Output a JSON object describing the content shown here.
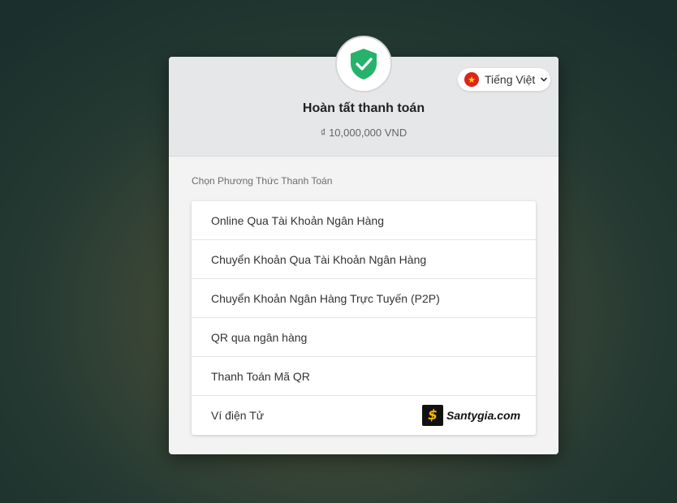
{
  "header": {
    "title": "Hoàn tất thanh toán",
    "amount": "₫ 10,000,000 VND",
    "status_icon": "shield-check-icon"
  },
  "language": {
    "label": "Tiếng Việt",
    "flag_icon": "vietnam-flag-icon",
    "flag_star": "★"
  },
  "payment": {
    "section_label": "Chọn Phương Thức Thanh Toán",
    "methods": [
      {
        "label": "Online Qua Tài Khoản Ngân Hàng"
      },
      {
        "label": "Chuyển Khoản Qua Tài Khoản Ngân Hàng"
      },
      {
        "label": "Chuyển Khoản Ngân Hàng Trực Tuyến (P2P)"
      },
      {
        "label": "QR qua ngân hàng"
      },
      {
        "label": "Thanh Toán Mã QR"
      },
      {
        "label": "Ví điện Tử"
      }
    ]
  },
  "watermark": {
    "logo_symbol": "$",
    "text": "Santygia.com"
  },
  "colors": {
    "shield_green": "#27b26b",
    "flag_red": "#da251d",
    "flag_star": "#ffde00",
    "watermark_accent": "#f5b800"
  }
}
